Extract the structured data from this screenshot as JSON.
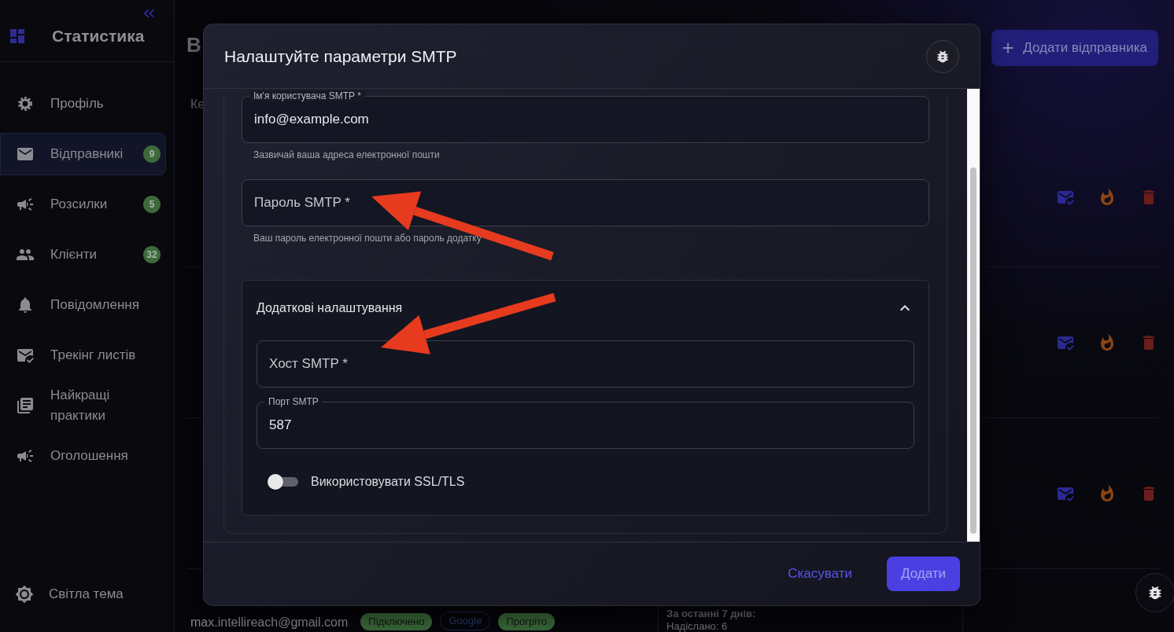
{
  "sidebar": {
    "title": "Статистика",
    "items": [
      {
        "label": "Профіль",
        "selected": false
      },
      {
        "label": "Відправникі",
        "badge": "9",
        "selected": true
      },
      {
        "label": "Розсилки",
        "badge": "5",
        "selected": false
      },
      {
        "label": "Клієнти",
        "badge": "32",
        "selected": false
      },
      {
        "label": "Повідомлення",
        "selected": false
      },
      {
        "label": "Трекінг листів",
        "selected": false
      },
      {
        "label": "Найкращі практики",
        "selected": false
      },
      {
        "label": "Оголошення",
        "selected": false
      }
    ],
    "theme_toggle": "Світла тема"
  },
  "page": {
    "heading": "В",
    "subtitle": "Ке",
    "add_button": "Додати відправника",
    "rows": [
      {
        "kind": "actions"
      },
      {
        "kind": "actions"
      },
      {
        "kind": "actions"
      },
      {
        "kind": "detail",
        "email": "max.intellireach@gmail.com",
        "tags": [
          {
            "label": "Підключено",
            "kind": "filled"
          },
          {
            "label": "Google",
            "kind": "outline"
          },
          {
            "label": "Прогріто",
            "kind": "filled"
          }
        ],
        "stats_title": "За останні 7 днів:",
        "stats": [
          "Надіслано: 6"
        ]
      }
    ]
  },
  "dialog": {
    "title": "Налаштуйте параметри SMTP",
    "fields": [
      {
        "label": "Ім'я користувача SMTP *",
        "value": "info@example.com",
        "helper": "Зазвичай ваша адреса електронної пошти"
      },
      {
        "label": "Пароль SMTP *",
        "helper": "Ваш пароль електронної пошти або пароль додатку"
      }
    ],
    "advanced": {
      "title": "Додаткові налаштування",
      "expanded": true,
      "fields": [
        {
          "label": "Хост SMTP *"
        },
        {
          "label": "Порт SMTP",
          "value": "587"
        }
      ],
      "toggle": {
        "label": "Використовувати SSL/TLS",
        "on": false
      }
    },
    "buttons": [
      {
        "label": "Скасувати",
        "kind": "text",
        "disabled": false
      },
      {
        "label": "Додати",
        "kind": "primary",
        "disabled": true
      }
    ]
  }
}
